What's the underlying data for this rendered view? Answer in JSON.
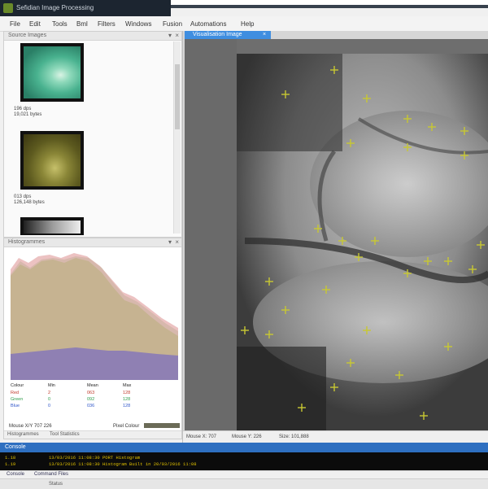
{
  "window": {
    "title": "Sefidian Image Processing"
  },
  "menu": [
    "File",
    "Edit",
    "Tools",
    "Bml",
    "Filters",
    "Windows",
    "Fusion",
    "Automations",
    "Help"
  ],
  "source_images": {
    "title": "Source Images",
    "items": [
      {
        "label": "196 dps",
        "size": "19,021 bytes"
      },
      {
        "label": "013 dps",
        "size": "126,148 bytes"
      }
    ]
  },
  "histogram": {
    "title": "Histogrammes",
    "headers": [
      "Colour",
      "Min",
      "Mean",
      "Max"
    ],
    "rows": [
      {
        "name": "Red",
        "min": "2",
        "mean": "063",
        "max": "128",
        "color": "#c0392b"
      },
      {
        "name": "Green",
        "min": "0",
        "mean": "092",
        "max": "128",
        "color": "#2e9c4a"
      },
      {
        "name": "Blue",
        "min": "0",
        "mean": "036",
        "max": "128",
        "color": "#2f56c9"
      }
    ],
    "mouse": "Mouse X/Y   707   226",
    "pixel_colour_label": "Pixel Colour",
    "tabs": [
      "Histogrammes",
      "Tool Statistics"
    ]
  },
  "viewer": {
    "tab_label": "Visualisation Image",
    "mouse_x": "Mouse X: 707",
    "mouse_y": "Mouse Y: 226",
    "size": "Size: 101,888"
  },
  "console": {
    "title": "Console",
    "lines": [
      {
        "no": "1.18",
        "text": "13/03/2016 11:08:30  PORT Histogram"
      },
      {
        "no": "1.19",
        "text": "13/03/2016 11:08:30  Histogram Built in 20/03/2016 11:08"
      }
    ],
    "tabs": [
      "Console",
      "Command Files"
    ],
    "status": "Status"
  },
  "colors": {
    "accent": "#3f8ee0",
    "console_bar": "#2e6fc0",
    "marker": "#c8c832",
    "titlebar": "#1c2530"
  },
  "icons": [
    "app-icon",
    "pin-icon",
    "close-icon",
    "scroll-up-icon",
    "scroll-down-icon"
  ]
}
